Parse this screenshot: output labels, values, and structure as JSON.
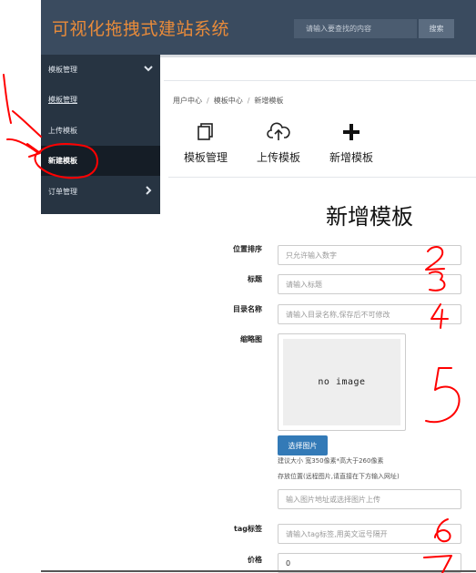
{
  "header": {
    "title": "可视化拖拽式建站系统",
    "search_placeholder": "请输入要查找的内容",
    "search_button": "搜索"
  },
  "sidebar": {
    "items": [
      {
        "label": "模板管理",
        "icon": "chevron-down-icon"
      },
      {
        "label": "模板管理"
      },
      {
        "label": "上传模板"
      },
      {
        "label": "新建模板"
      },
      {
        "label": "订单管理",
        "icon": "chevron-right-icon"
      }
    ]
  },
  "breadcrumb": [
    "用户中心",
    "模板中心",
    "新增模板"
  ],
  "toolbar": [
    {
      "label": "模板管理",
      "icon": "copy-icon"
    },
    {
      "label": "上传模板",
      "icon": "cloud-upload-icon"
    },
    {
      "label": "新增模板",
      "icon": "plus-icon"
    }
  ],
  "form": {
    "title": "新增模板",
    "position_label": "位置排序",
    "position_placeholder": "只允许输入数字",
    "title_label": "标题",
    "title_placeholder": "请输入标题",
    "dir_label": "目录名称",
    "dir_placeholder": "请输入目录名称,保存后不可修改",
    "thumb_label": "缩略图",
    "thumb_text": "no image",
    "pick_button": "选择图片",
    "hint_size": "建议大小 宽350像素*高大于260像素",
    "hint_location": "存放位置(远程图片,请直接在下方输入网址)",
    "url_placeholder": "输入图片地址或选择图片上传",
    "tag_label": "tag标签",
    "tag_placeholder": "请输入tag标签,用英文逗号隔开",
    "price_label": "价格",
    "price_value": "0"
  },
  "annotations": [
    "1",
    "2",
    "3",
    "4",
    "5",
    "6",
    "7"
  ],
  "colors": {
    "header_bg": "#3a4b5f",
    "title_orange": "#e98b3a",
    "sidebar_bg": "#273442",
    "button_blue": "#337ab7",
    "annotation_red": "#ff0000"
  }
}
